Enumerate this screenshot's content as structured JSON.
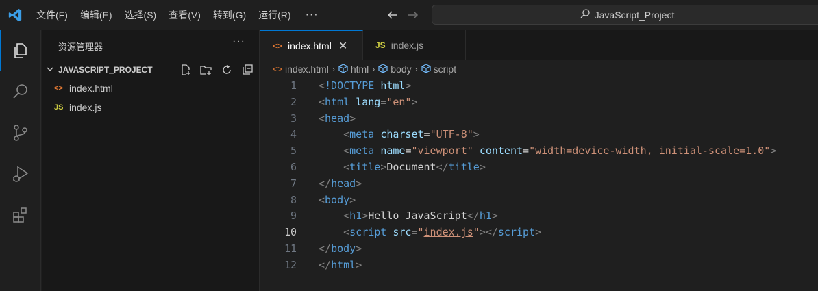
{
  "titlebar": {
    "menu": [
      "文件(F)",
      "编辑(E)",
      "选择(S)",
      "查看(V)",
      "转到(G)",
      "运行(R)"
    ],
    "more": "···",
    "search_text": "JavaScript_Project"
  },
  "activity": [
    "explorer-icon",
    "search-icon",
    "source-control-icon",
    "run-debug-icon",
    "extensions-icon"
  ],
  "sidebar": {
    "header": "资源管理器",
    "more": "···",
    "folder": "JAVASCRIPT_PROJECT",
    "files": [
      {
        "icon": "<>",
        "name": "index.html",
        "color": "#e37933"
      },
      {
        "icon": "JS",
        "name": "index.js",
        "color": "#cbcb41"
      }
    ]
  },
  "tabs": [
    {
      "icon": "<>",
      "label": "index.html",
      "active": true,
      "close": "✕"
    },
    {
      "icon": "JS",
      "label": "index.js",
      "active": false
    }
  ],
  "breadcrumb": [
    "index.html",
    "html",
    "body",
    "script"
  ],
  "editor": {
    "current_line": 10,
    "lines": [
      {
        "n": "1",
        "tokens": [
          [
            "punct",
            "<"
          ],
          [
            "tag",
            "!DOCTYPE"
          ],
          [
            "text",
            " "
          ],
          [
            "attr",
            "html"
          ],
          [
            "punct",
            ">"
          ]
        ]
      },
      {
        "n": "2",
        "tokens": [
          [
            "punct",
            "<"
          ],
          [
            "tag",
            "html"
          ],
          [
            "text",
            " "
          ],
          [
            "attr",
            "lang"
          ],
          [
            "text",
            "="
          ],
          [
            "str",
            "\"en\""
          ],
          [
            "punct",
            ">"
          ]
        ]
      },
      {
        "n": "3",
        "tokens": [
          [
            "punct",
            "<"
          ],
          [
            "tag",
            "head"
          ],
          [
            "punct",
            ">"
          ]
        ]
      },
      {
        "n": "4",
        "tokens": [
          [
            "text",
            "    "
          ],
          [
            "punct",
            "<"
          ],
          [
            "tag",
            "meta"
          ],
          [
            "text",
            " "
          ],
          [
            "attr",
            "charset"
          ],
          [
            "text",
            "="
          ],
          [
            "str",
            "\"UTF-8\""
          ],
          [
            "punct",
            ">"
          ]
        ]
      },
      {
        "n": "5",
        "tokens": [
          [
            "text",
            "    "
          ],
          [
            "punct",
            "<"
          ],
          [
            "tag",
            "meta"
          ],
          [
            "text",
            " "
          ],
          [
            "attr",
            "name"
          ],
          [
            "text",
            "="
          ],
          [
            "str",
            "\"viewport\""
          ],
          [
            "text",
            " "
          ],
          [
            "attr",
            "content"
          ],
          [
            "text",
            "="
          ],
          [
            "str",
            "\"width=device-width, initial-scale=1.0\""
          ],
          [
            "punct",
            ">"
          ]
        ]
      },
      {
        "n": "6",
        "tokens": [
          [
            "text",
            "    "
          ],
          [
            "punct",
            "<"
          ],
          [
            "tag",
            "title"
          ],
          [
            "punct",
            ">"
          ],
          [
            "text",
            "Document"
          ],
          [
            "punct",
            "</"
          ],
          [
            "tag",
            "title"
          ],
          [
            "punct",
            ">"
          ]
        ]
      },
      {
        "n": "7",
        "tokens": [
          [
            "punct",
            "</"
          ],
          [
            "tag",
            "head"
          ],
          [
            "punct",
            ">"
          ]
        ]
      },
      {
        "n": "8",
        "tokens": [
          [
            "punct",
            "<"
          ],
          [
            "tag",
            "body"
          ],
          [
            "punct",
            ">"
          ]
        ]
      },
      {
        "n": "9",
        "tokens": [
          [
            "text",
            "    "
          ],
          [
            "punct",
            "<"
          ],
          [
            "tag",
            "h1"
          ],
          [
            "punct",
            ">"
          ],
          [
            "text",
            "Hello JavaScript"
          ],
          [
            "punct",
            "</"
          ],
          [
            "tag",
            "h1"
          ],
          [
            "punct",
            ">"
          ]
        ]
      },
      {
        "n": "10",
        "tokens": [
          [
            "text",
            "    "
          ],
          [
            "punct",
            "<"
          ],
          [
            "tag",
            "script"
          ],
          [
            "text",
            " "
          ],
          [
            "attr",
            "src"
          ],
          [
            "text",
            "="
          ],
          [
            "str",
            "\""
          ],
          [
            "strlink",
            "index.js"
          ],
          [
            "str",
            "\""
          ],
          [
            "punct",
            "></"
          ],
          [
            "tag",
            "script"
          ],
          [
            "punct",
            ">"
          ]
        ]
      },
      {
        "n": "11",
        "tokens": [
          [
            "punct",
            "</"
          ],
          [
            "tag",
            "body"
          ],
          [
            "punct",
            ">"
          ]
        ]
      },
      {
        "n": "12",
        "tokens": [
          [
            "punct",
            "</"
          ],
          [
            "tag",
            "html"
          ],
          [
            "punct",
            ">"
          ]
        ]
      }
    ]
  },
  "colors": {
    "accent": "#0078d4",
    "html_icon": "#e37933",
    "js_icon": "#cbcb41",
    "vscode_logo": "#3b9ee8"
  }
}
